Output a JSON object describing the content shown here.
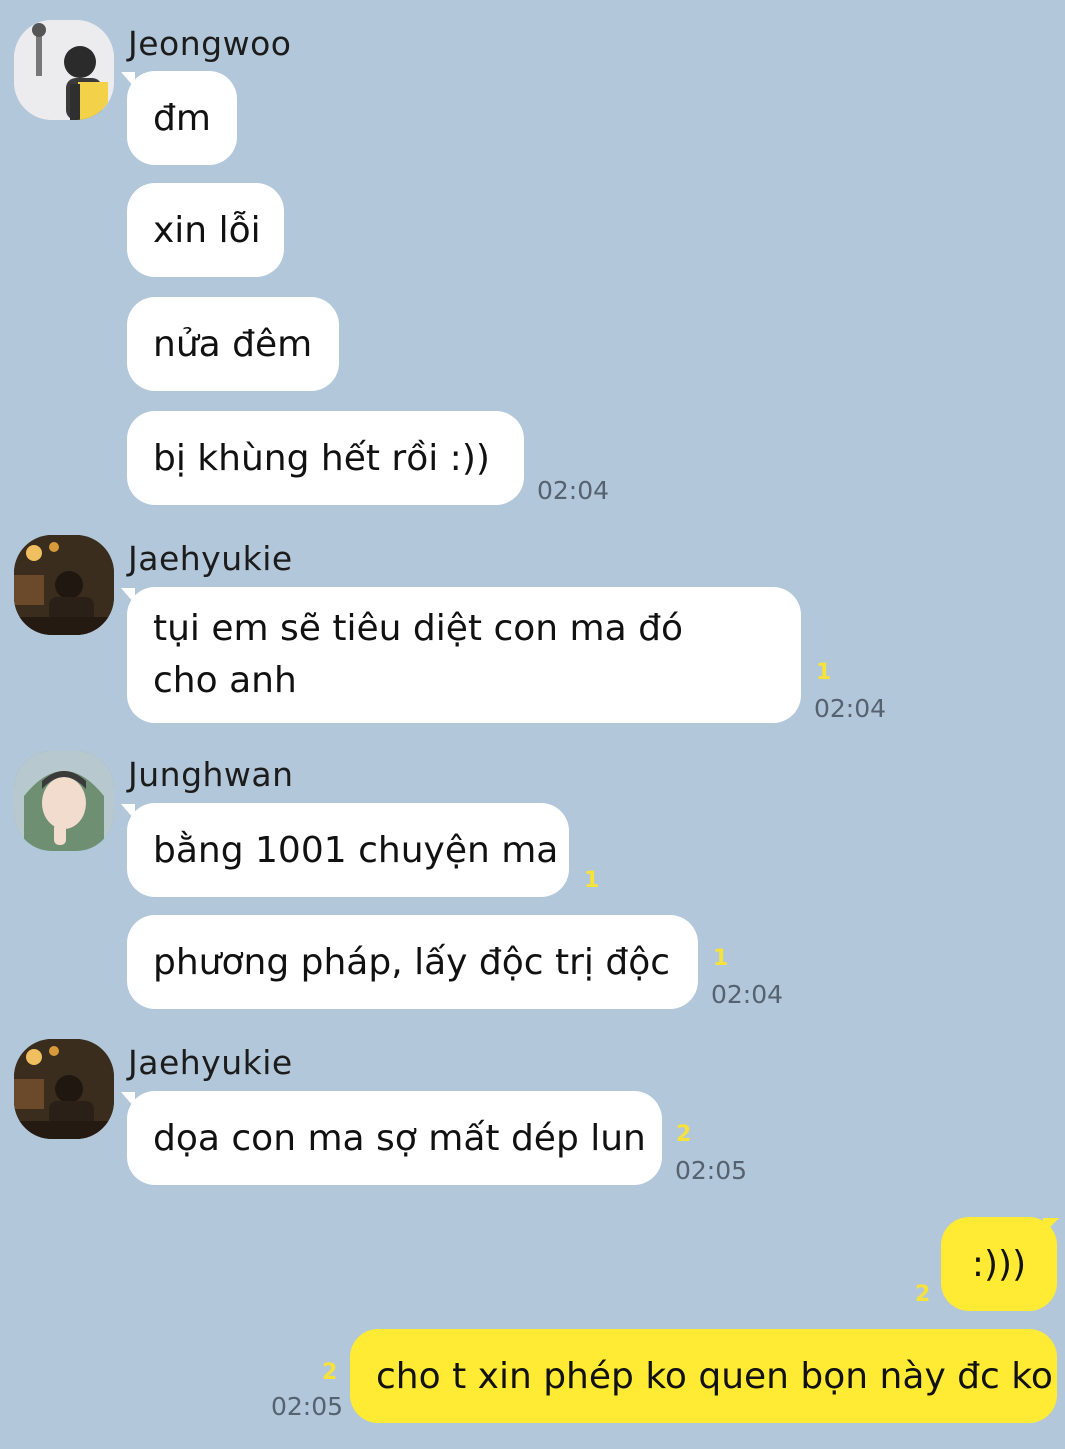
{
  "colors": {
    "background": "#b2c7da",
    "bubble_other": "#ffffff",
    "bubble_me": "#ffeb33",
    "unread": "#f7e13b"
  },
  "groups": [
    {
      "sender": "Jeongwoo",
      "avatar_icon": "jeongwoo-avatar",
      "messages": [
        {
          "text": "đm"
        },
        {
          "text": "xin lỗi"
        },
        {
          "text": "nửa đêm"
        },
        {
          "text": "bị khùng hết rồi :))",
          "time": "02:04"
        }
      ]
    },
    {
      "sender": "Jaehyukie",
      "avatar_icon": "jaehyukie-avatar",
      "messages": [
        {
          "text": "tụi em sẽ tiêu diệt con ma đó cho anh",
          "unread": "1",
          "time": "02:04"
        }
      ]
    },
    {
      "sender": "Junghwan",
      "avatar_icon": "junghwan-avatar",
      "messages": [
        {
          "text": "bằng 1001 chuyện ma",
          "unread": "1"
        },
        {
          "text": "phương pháp, lấy độc trị độc",
          "unread": "1",
          "time": "02:04"
        }
      ]
    },
    {
      "sender": "Jaehyukie",
      "avatar_icon": "jaehyukie-avatar",
      "messages": [
        {
          "text": "dọa con ma sợ mất dép lun",
          "unread": "2",
          "time": "02:05"
        }
      ]
    }
  ],
  "my_messages": [
    {
      "text": ":)))",
      "unread": "2"
    },
    {
      "text": "cho t xin phép ko quen bọn này đc ko",
      "unread": "2",
      "time": "02:05"
    }
  ]
}
